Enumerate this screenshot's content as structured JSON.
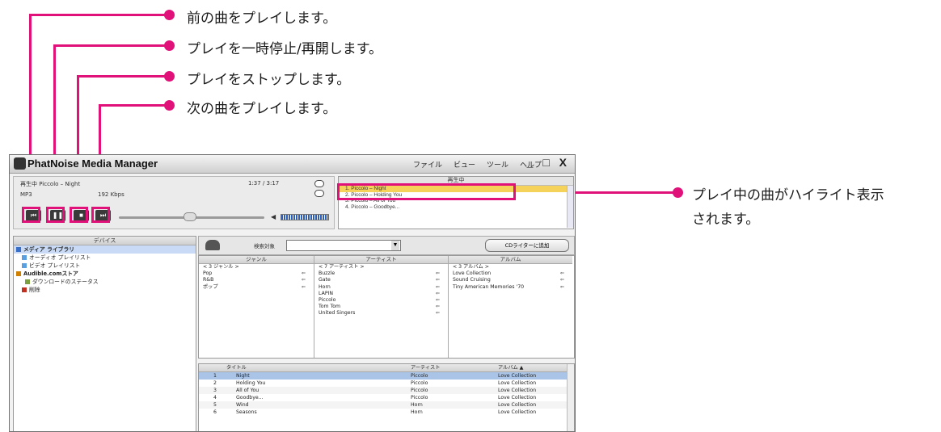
{
  "annotations": {
    "prev": "前の曲をプレイします。",
    "pause": "プレイを一時停止/再開します。",
    "stop": "プレイをストップします。",
    "next": "次の曲をプレイします。",
    "highlight_line1": "プレイ中の曲がハイライト表示",
    "highlight_line2": "されます。",
    "accent_color": "#e0127a"
  },
  "window": {
    "title": "PhatNoise Media Manager",
    "menus": [
      "ファイル",
      "ビュー",
      "ツール",
      "ヘルプ"
    ],
    "controls": "_ □ X"
  },
  "player": {
    "now_playing_label": "再生中 Piccolo – Night",
    "time": "1:37 / 3:17",
    "format": "MP3",
    "bitrate": "192 Kbps",
    "volume_icon": "speaker-icon",
    "buttons": {
      "prev": "⏮",
      "pause": "❚❚",
      "stop": "■",
      "next": "⏭"
    }
  },
  "now_playing": {
    "header": "再生中",
    "items": [
      "1. Piccolo – Night",
      "2. Piccolo – Holding You",
      "3. Piccolo – All of You",
      "4. Piccolo – Goodbye..."
    ],
    "selected_index": 0
  },
  "devices": {
    "header": "デバイス",
    "items": [
      {
        "label": "メディア ライブラリ",
        "icon_color": "#3a6fc8"
      },
      {
        "label": "オーディオ プレイリスト",
        "icon_color": "#5aa0e0"
      },
      {
        "label": "ビデオ プレイリスト",
        "icon_color": "#5aa0e0"
      },
      {
        "label": "Audible.comストア",
        "icon_color": "#d08000"
      },
      {
        "label": "ダウンロードのステータス",
        "icon_color": "#7aa040"
      },
      {
        "label": "削除",
        "icon_color": "#c03020"
      }
    ]
  },
  "search": {
    "label": "検索対象",
    "add_button": "CDライターに追加"
  },
  "browse": {
    "genre": {
      "header": "ジャンル",
      "items": [
        "< 3 ジャンル >",
        "Pop",
        "R&B",
        "ポップ"
      ]
    },
    "artist": {
      "header": "アーティスト",
      "items": [
        "< 7 アーティスト >",
        "Buzzle",
        "Gate",
        "Horn",
        "LAPIN",
        "Piccolo",
        "Tom Tom",
        "United Singers"
      ]
    },
    "album": {
      "header": "アルバム",
      "items": [
        "< 3 アルバム >",
        "Love Collection",
        "Sound Cruising",
        "Tiny American Memories '70"
      ]
    }
  },
  "tracks": {
    "columns": {
      "title": "タイトル",
      "artist": "アーティスト",
      "album": "アルバム ▲"
    },
    "rows": [
      {
        "num": "1",
        "title": "Night",
        "artist": "Piccolo",
        "album": "Love Collection"
      },
      {
        "num": "2",
        "title": "Holding You",
        "artist": "Piccolo",
        "album": "Love Collection"
      },
      {
        "num": "3",
        "title": "All of You",
        "artist": "Piccolo",
        "album": "Love Collection"
      },
      {
        "num": "4",
        "title": "Goodbye...",
        "artist": "Piccolo",
        "album": "Love Collection"
      },
      {
        "num": "5",
        "title": "Wind",
        "artist": "Horn",
        "album": "Love Collection"
      },
      {
        "num": "6",
        "title": "Seasons",
        "artist": "Horn",
        "album": "Love Collection"
      }
    ],
    "selected_index": 0
  }
}
